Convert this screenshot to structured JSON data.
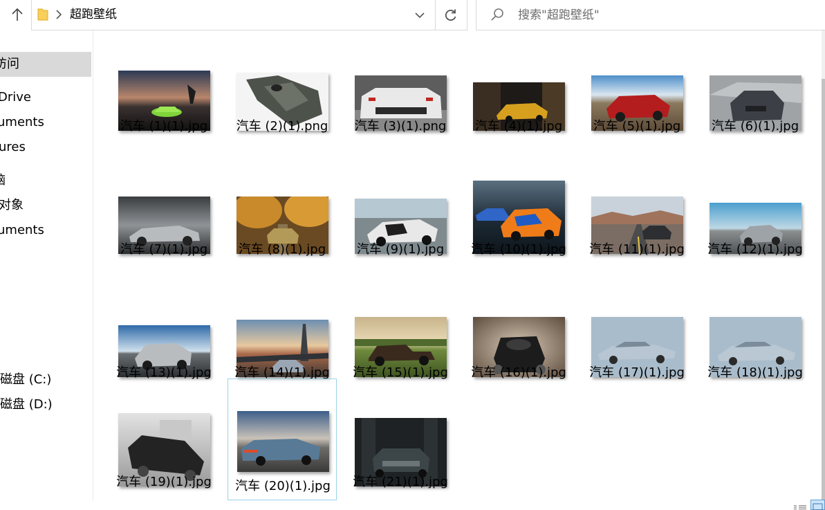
{
  "address": {
    "path": "超跑壁纸",
    "icons": {
      "up": "arrow-up-icon",
      "folder": "folder-icon",
      "separator": "chevron-right-icon",
      "dropdown": "chevron-down-icon",
      "refresh": "refresh-icon"
    }
  },
  "search": {
    "placeholder": "搜索\"超跑壁纸\"",
    "icon": "search-icon"
  },
  "nav": {
    "items": [
      {
        "label": "访问",
        "selected": true
      },
      {
        "label": "Drive"
      },
      {
        "label": "uments"
      },
      {
        "label": "ures"
      },
      {
        "label": "脑"
      },
      {
        "label": "对象"
      },
      {
        "label": "uments"
      },
      {
        "label": "磁盘 (C:)"
      },
      {
        "label": "磁盘 (D:)"
      }
    ]
  },
  "files": [
    {
      "name": "汽车 (1)(1).jpg"
    },
    {
      "name": "汽车 (2)(1).png"
    },
    {
      "name": "汽车 (3)(1).png"
    },
    {
      "name": "汽车 (4)(1).jpg"
    },
    {
      "name": "汽车 (5)(1).jpg"
    },
    {
      "name": "汽车 (6)(1).jpg"
    },
    {
      "name": "汽车 (7)(1).jpg"
    },
    {
      "name": "汽车 (8)(1).jpg"
    },
    {
      "name": "汽车 (9)(1).jpg"
    },
    {
      "name": "汽车 (10)(1).jpg"
    },
    {
      "name": "汽车 (11)(1).jpg"
    },
    {
      "name": "汽车 (12)(1).jpg"
    },
    {
      "name": "汽车 (13)(1).jpg"
    },
    {
      "name": "汽车 (14)(1).jpg"
    },
    {
      "name": "汽车 (15)(1).jpg"
    },
    {
      "name": "汽车 (16)(1).jpg"
    },
    {
      "name": "汽车 (17)(1).jpg"
    },
    {
      "name": "汽车 (18)(1).jpg"
    },
    {
      "name": "汽车 (19)(1).jpg"
    },
    {
      "name": "汽车 (20)(1).jpg",
      "selected": true
    },
    {
      "name": "汽车 (21)(1).jpg"
    }
  ],
  "colors": {
    "selection_border": "#9ad3e8",
    "nav_selected": "#d9d9d9",
    "view_active": "#cce4f7"
  }
}
